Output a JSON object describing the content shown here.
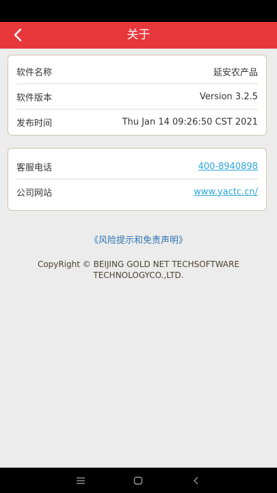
{
  "header": {
    "title": "关于",
    "back_icon": "chevron-left-icon"
  },
  "app_info": {
    "rows": [
      {
        "label": "软件名称",
        "value": "延安农产品"
      },
      {
        "label": "软件版本",
        "value": "Version 3.2.5"
      },
      {
        "label": "发布时间",
        "value": "Thu Jan 14 09:26:50 CST 2021"
      }
    ]
  },
  "contact": {
    "phone_label": "客服电话",
    "phone_value": "400-8940898",
    "website_label": "公司网站",
    "website_value": "www.yactc.cn/"
  },
  "disclaimer": {
    "link_text": "《风险提示和免责声明》"
  },
  "copyright": {
    "line1": "CopyRight ©  BEIJING GOLD NET TECHSOFTWARE",
    "line2": "TECHNOLOGYCO.,LTD."
  },
  "nav_bar": {
    "menu_icon": "menu-icon",
    "home_icon": "home-square-icon",
    "back_icon": "back-triangle-icon"
  },
  "colors": {
    "header_bg": "#e8373b",
    "page_bg": "#ececec",
    "link": "#2aa6da",
    "disclaimer_link": "#2e74b5",
    "card_border": "#cfc4b3"
  }
}
